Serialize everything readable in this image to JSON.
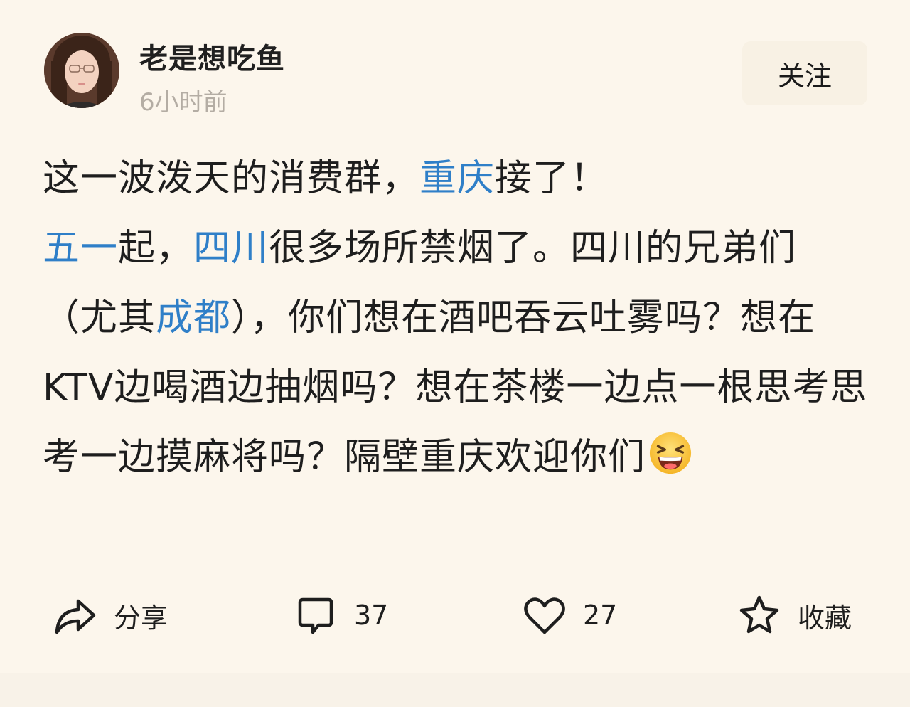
{
  "post": {
    "author": {
      "name": "老是想吃鱼",
      "time": "6小时前",
      "avatar_icon": "avatar-photo"
    },
    "follow_label": "关注",
    "content": {
      "line1_a": "这一波泼天的消费群，",
      "line1_link": "重庆",
      "line1_b": "接了！",
      "p2_link1": "五一",
      "p2_a": "起，",
      "p2_link2": "四川",
      "p2_b": "很多场所禁烟了。四川的兄弟们（尤其",
      "p2_link3": "成都",
      "p2_c": "），你们想在酒吧吞云吐雾吗？想在KTV边喝酒边抽烟吗？想在茶楼一边点一根思考思考一边摸麻将吗？隔壁重庆欢迎你们",
      "emoji": "grinning-squinting-face"
    },
    "actions": {
      "share_label": "分享",
      "comment_count": "37",
      "like_count": "27",
      "favorite_label": "收藏"
    }
  },
  "colors": {
    "background": "#fcf6ec",
    "link": "#2f7fc8",
    "secondary_text": "#b4ada4",
    "follow_button_bg": "#f8f1e4"
  }
}
